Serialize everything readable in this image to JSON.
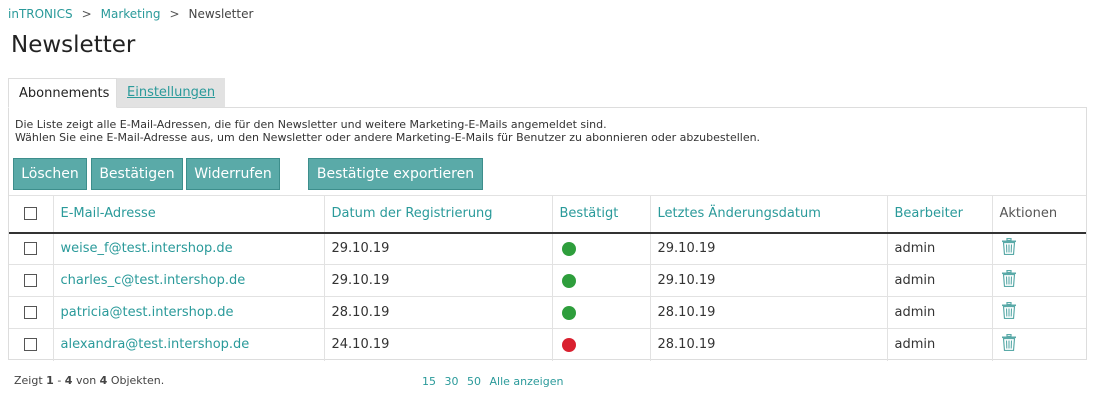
{
  "breadcrumb": {
    "items": [
      "inTRONICS",
      "Marketing"
    ],
    "separator": ">",
    "current": "Newsletter"
  },
  "page": {
    "title": "Newsletter"
  },
  "tabs": [
    {
      "label": "Abonnements",
      "active": true
    },
    {
      "label": "Einstellungen",
      "active": false
    }
  ],
  "description": {
    "line1": "Die Liste zeigt alle E-Mail-Adressen, die für den Newsletter und weitere Marketing-E-Mails angemeldet sind.",
    "line2": "Wählen Sie eine E-Mail-Adresse aus, um den Newsletter oder andere Marketing-E-Mails für Benutzer zu abonnieren oder abzubestellen."
  },
  "buttons": {
    "delete": "Löschen",
    "confirm": "Bestätigen",
    "revoke": "Widerrufen",
    "export": "Bestätigte exportieren"
  },
  "table": {
    "columns": [
      "E-Mail-Adresse",
      "Datum der Registrierung",
      "Bestätigt",
      "Letztes Änderungsdatum",
      "Bearbeiter",
      "Aktionen"
    ],
    "rows": [
      {
        "email": "weise_f@test.intershop.de",
        "registered": "29.10.19",
        "confirmed": true,
        "changed": "29.10.19",
        "editor": "admin"
      },
      {
        "email": "charles_c@test.intershop.de",
        "registered": "29.10.19",
        "confirmed": true,
        "changed": "29.10.19",
        "editor": "admin"
      },
      {
        "email": "patricia@test.intershop.de",
        "registered": "28.10.19",
        "confirmed": true,
        "changed": "28.10.19",
        "editor": "admin"
      },
      {
        "email": "alexandra@test.intershop.de",
        "registered": "24.10.19",
        "confirmed": false,
        "changed": "28.10.19",
        "editor": "admin"
      }
    ]
  },
  "footer": {
    "prefix": "Zeigt",
    "from": "1",
    "dash": "-",
    "to": "4",
    "of_label": "von",
    "total": "4",
    "suffix": "Objekten."
  },
  "pagination": {
    "sizes": [
      "15",
      "30",
      "50"
    ],
    "show_all": "Alle anzeigen"
  },
  "colors": {
    "accent": "#2a9a9a",
    "button": "#5aaaa8",
    "confirmed": "#2e9e3c",
    "unconfirmed": "#d9202f"
  },
  "icons": {
    "delete_action": "trash-icon"
  }
}
